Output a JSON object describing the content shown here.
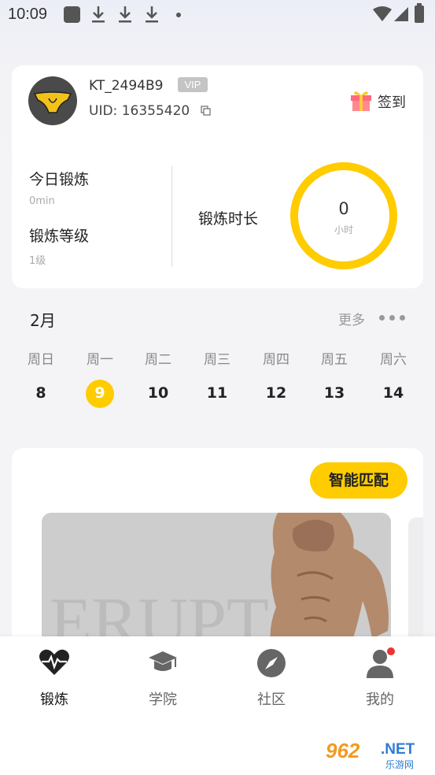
{
  "status_bar": {
    "time": "10:09"
  },
  "profile": {
    "username": "KT_2494B9",
    "vip_badge": "VIP",
    "uid_label": "UID:",
    "uid_value": "16355420",
    "checkin_label": "签到"
  },
  "stats": {
    "today_label": "今日锻炼",
    "today_value": "0min",
    "level_label": "锻炼等级",
    "level_value": "1级",
    "duration_label": "锻炼时长",
    "duration_value": "0",
    "duration_unit": "小时",
    "ring_progress": 0
  },
  "calendar": {
    "month": "2月",
    "more_label": "更多",
    "weekdays": [
      "周日",
      "周一",
      "周二",
      "周三",
      "周四",
      "周五",
      "周六"
    ],
    "days": [
      "8",
      "9",
      "10",
      "11",
      "12",
      "13",
      "14"
    ],
    "selected_index": 1
  },
  "training": {
    "match_button": "智能匹配",
    "image_text": "ERUPT"
  },
  "bottom_nav": {
    "items": [
      {
        "label": "锻炼",
        "icon": "heartbeat-icon",
        "active": true
      },
      {
        "label": "学院",
        "icon": "graduation-cap-icon",
        "active": false
      },
      {
        "label": "社区",
        "icon": "compass-icon",
        "active": false
      },
      {
        "label": "我的",
        "icon": "user-icon",
        "active": false
      }
    ]
  },
  "watermark": {
    "brand": "962",
    "suffix": ".NET",
    "sub": "乐游网"
  },
  "colors": {
    "accent": "#ffcc00",
    "card": "#ffffff",
    "background": "#f4f4f6"
  }
}
